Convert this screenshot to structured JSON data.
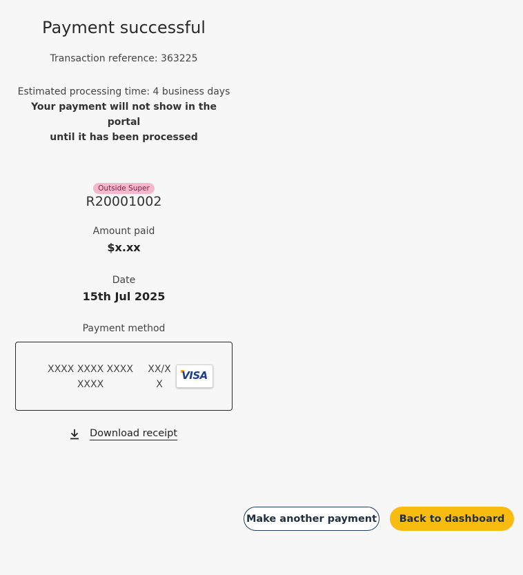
{
  "header": {
    "title": "Payment successful",
    "transaction_reference": "Transaction reference: 363225"
  },
  "processing": {
    "estimate": "Estimated processing time: 4 business days",
    "notice_line1": "Your payment will not show in the portal",
    "notice_line2": "until it has been processed"
  },
  "account": {
    "badge": "Outside Super",
    "number": "R20001002",
    "badge_color": "#f3b8cc"
  },
  "details": {
    "amount_label": "Amount paid",
    "amount_value": "$x.xx",
    "date_label": "Date",
    "date_value": "15th Jul 2025",
    "method_label": "Payment method"
  },
  "card": {
    "number_line1": "XXXX XXXX XXXX",
    "number_line2": "XXXX",
    "expiry_line1": "XX/X",
    "expiry_line2": "X",
    "brand": "VISA",
    "brand_icon": "visa-card-icon"
  },
  "actions": {
    "download_label": "Download receipt",
    "download_icon": "download-icon",
    "make_another_label": "Make another payment",
    "back_label": "Back to dashboard",
    "primary_color": "#f8bb0f",
    "outline_color": "#1f3d5a"
  }
}
